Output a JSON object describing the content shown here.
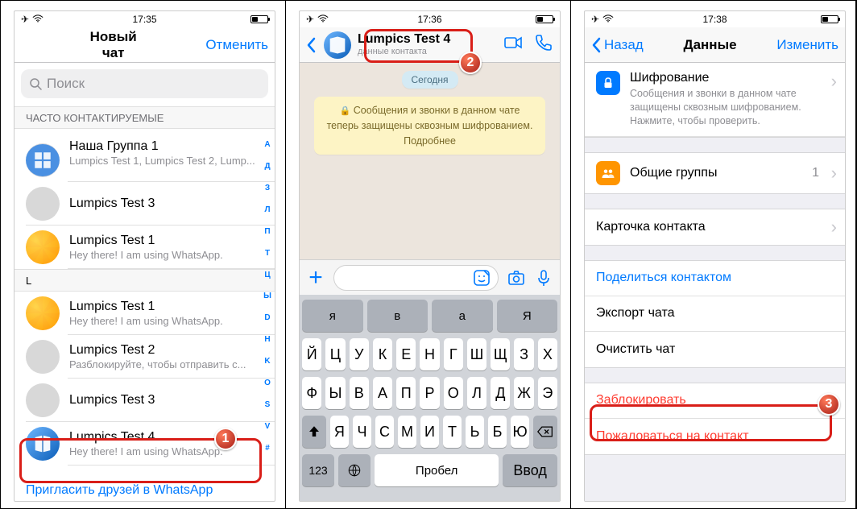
{
  "status": {
    "time1": "17:35",
    "time2": "17:36",
    "time3": "17:38"
  },
  "pane1": {
    "title": "Новый чат",
    "cancel": "Отменить",
    "search_placeholder": "Поиск",
    "frequent_header": "ЧАСТО КОНТАКТИРУЕМЫЕ",
    "group_name": "Наша Группа 1",
    "group_sub": "Lumpics Test 1, Lumpics Test 2, Lump...",
    "c3": "Lumpics Test 3",
    "c1": "Lumpics Test 1",
    "c1_sub": "Hey there! I am using WhatsApp.",
    "letter": "L",
    "l1": "Lumpics Test 1",
    "l1_sub": "Hey there! I am using WhatsApp.",
    "l2": "Lumpics Test 2",
    "l2_sub": "Разблокируйте, чтобы отправить с...",
    "l3": "Lumpics Test 3",
    "l4": "Lumpics Test 4",
    "l4_sub": "Hey there! I am using WhatsApp.",
    "invite": "Пригласить друзей в WhatsApp",
    "index": [
      "А",
      "Д",
      "З",
      "Л",
      "П",
      "Т",
      "Ц",
      "Ы",
      "D",
      "H",
      "K",
      "O",
      "S",
      "V",
      "#"
    ]
  },
  "pane2": {
    "contact_name": "Lumpics Test 4",
    "contact_sub": "данные контакта",
    "date": "Сегодня",
    "encryption": "Сообщения и звонки в данном чате теперь защищены сквозным шифрованием. Подробнее",
    "keyboard": {
      "row0": [
        "я",
        "в",
        "а",
        "Я"
      ],
      "row1": [
        "Й",
        "Ц",
        "У",
        "К",
        "Е",
        "Н",
        "Г",
        "Ш",
        "Щ",
        "З",
        "Х"
      ],
      "row2": [
        "Ф",
        "Ы",
        "В",
        "А",
        "П",
        "Р",
        "О",
        "Л",
        "Д",
        "Ж",
        "Э"
      ],
      "row3": [
        "Я",
        "Ч",
        "С",
        "М",
        "И",
        "Т",
        "Ь",
        "Б",
        "Ю"
      ],
      "k123": "123",
      "space": "Пробел",
      "enter": "Ввод"
    }
  },
  "pane3": {
    "back": "Назад",
    "title": "Данные",
    "edit": "Изменить",
    "enc_title": "Шифрование",
    "enc_sub": "Сообщения и звонки в данном чате защищены сквозным шифрованием. Нажмите, чтобы проверить.",
    "groups": "Общие группы",
    "groups_count": "1",
    "card": "Карточка контакта",
    "share": "Поделиться контактом",
    "export": "Экспорт чата",
    "clear": "Очистить чат",
    "block": "Заблокировать",
    "report": "Пожаловаться на контакт"
  },
  "badges": {
    "b1": "1",
    "b2": "2",
    "b3": "3"
  }
}
